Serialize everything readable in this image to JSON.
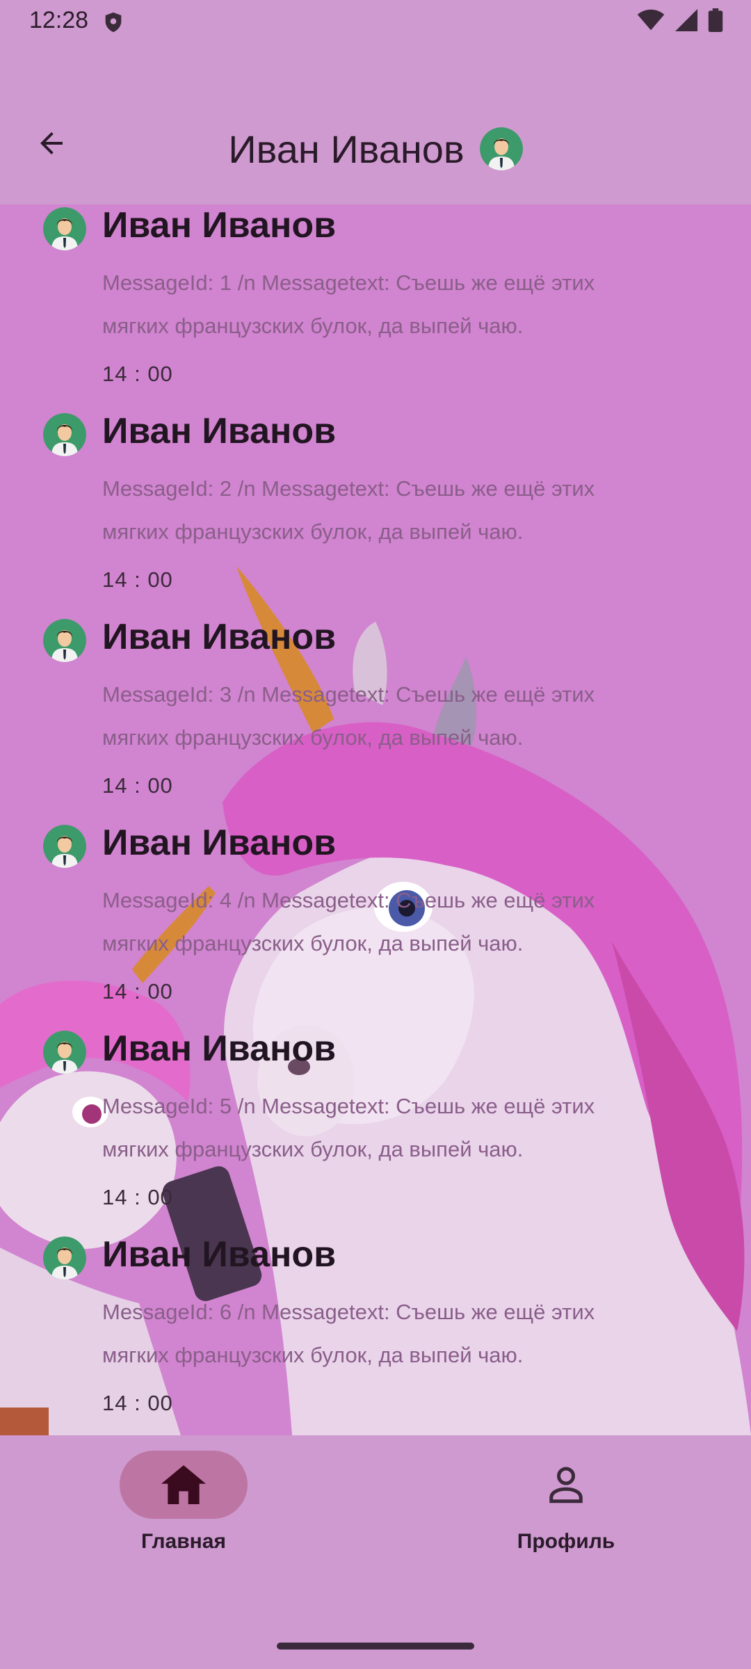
{
  "status_bar": {
    "time": "12:28"
  },
  "header": {
    "title": "Иван Иванов",
    "back_icon": "arrow-left-icon",
    "avatar_icon": "user-avatar-icon"
  },
  "messages": [
    {
      "author": "Иван Иванов",
      "text": "MessageId: 1 /n Messagetext: Съешь же ещё этих мягких французских булок, да выпей чаю.",
      "time": "14 : 00"
    },
    {
      "author": "Иван Иванов",
      "text": "MessageId: 2 /n Messagetext: Съешь же ещё этих мягких французских булок, да выпей чаю.",
      "time": "14 : 00"
    },
    {
      "author": "Иван Иванов",
      "text": "MessageId: 3 /n Messagetext: Съешь же ещё этих мягких французских булок, да выпей чаю.",
      "time": "14 : 00"
    },
    {
      "author": "Иван Иванов",
      "text": "MessageId: 4 /n Messagetext: Съешь же ещё этих мягких французских булок, да выпей чаю.",
      "time": "14 : 00"
    },
    {
      "author": "Иван Иванов",
      "text": "MessageId: 5 /n Messagetext: Съешь же ещё этих мягких французских булок, да выпей чаю.",
      "time": "14 : 00"
    },
    {
      "author": "Иван Иванов",
      "text": "MessageId: 6 /n Messagetext: Съешь же ещё этих мягких французских булок, да выпей чаю.",
      "time": "14 : 00"
    }
  ],
  "bottom_nav": {
    "items": [
      {
        "label": "Главная",
        "icon": "home-icon",
        "selected": true
      },
      {
        "label": "Профиль",
        "icon": "person-icon",
        "selected": false
      }
    ]
  },
  "colors": {
    "app_bar": "#cf9acf",
    "chat_background": "#d184cf",
    "nav_selected_pill": "#bd76a3",
    "text_primary": "#221522",
    "text_message": "#8a5e8a"
  }
}
